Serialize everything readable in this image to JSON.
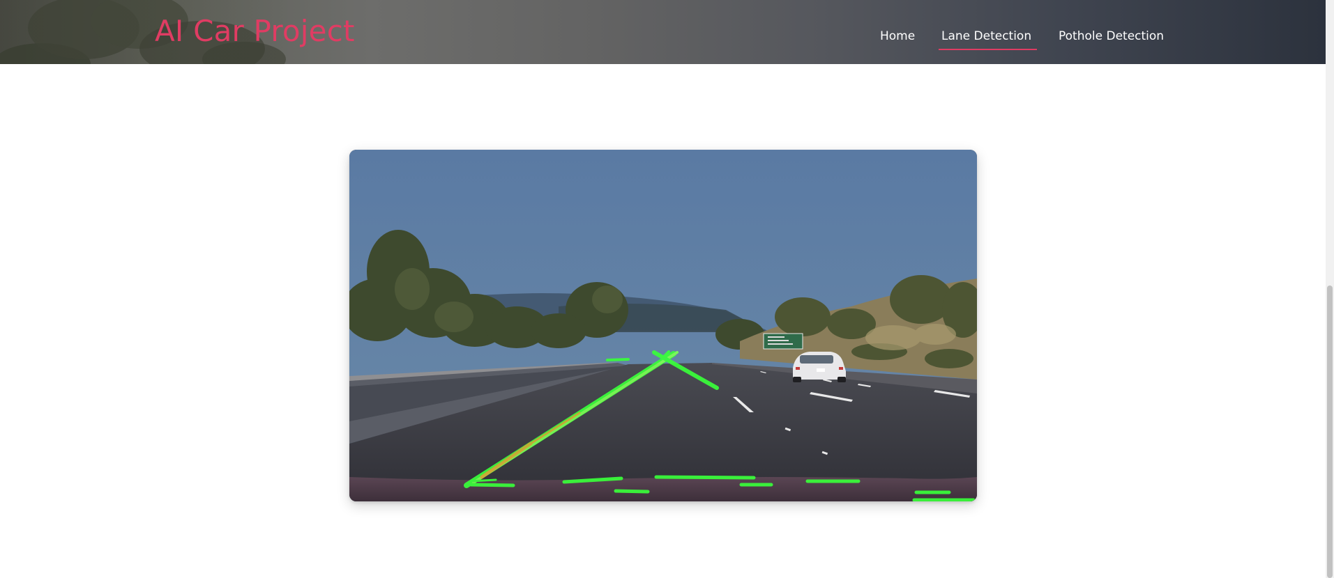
{
  "header": {
    "brand": "AI Car Project",
    "nav": [
      {
        "label": "Home",
        "active": false
      },
      {
        "label": "Lane Detection",
        "active": true
      },
      {
        "label": "Pothole Detection",
        "active": false
      }
    ]
  },
  "main": {
    "video_feed": {
      "description_sign_text": [
        "Stanford",
        "Palo Alto",
        "San Francisco"
      ],
      "overlay_color": "#39ff3a"
    }
  },
  "colors": {
    "accent": "#e03c63",
    "nav_text": "#ffffff",
    "lane_overlay": "#39ff3a"
  }
}
